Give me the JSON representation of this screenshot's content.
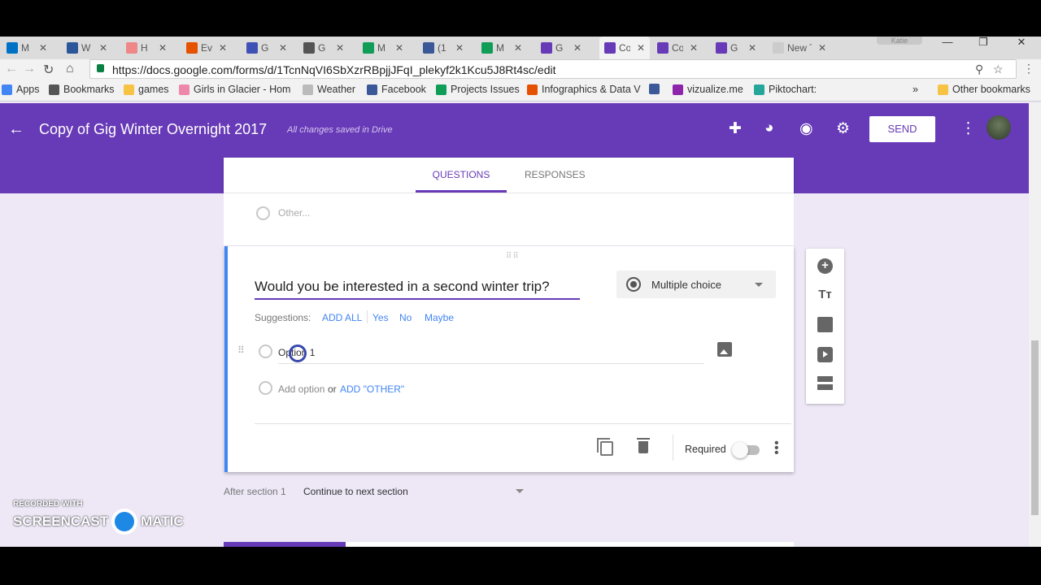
{
  "browser": {
    "tabs": [
      {
        "label": "M",
        "color": "#0072c6"
      },
      {
        "label": "W",
        "color": "#2b579a"
      },
      {
        "label": "H",
        "color": "#e88"
      },
      {
        "label": "Ev",
        "color": "#e65100"
      },
      {
        "label": "G",
        "color": "#3f51b5"
      },
      {
        "label": "G",
        "color": "#555"
      },
      {
        "label": "M",
        "color": "#0f9d58"
      },
      {
        "label": "(1",
        "color": "#3b5998"
      },
      {
        "label": "M",
        "color": "#0f9d58"
      },
      {
        "label": "G",
        "color": "#673ab7"
      },
      {
        "label": "Co",
        "color": "#673ab7",
        "active": true
      },
      {
        "label": "Co",
        "color": "#673ab7"
      },
      {
        "label": "G",
        "color": "#673ab7"
      },
      {
        "label": "New T",
        "color": "#ccc"
      }
    ],
    "profile": "Katie",
    "url": "https://docs.google.com/forms/d/1TcnNqVI6SbXzrRBpjjJFqI_plekyf2k1Kcu5J8Rt4sc/edit",
    "bookmarks": [
      {
        "label": "Apps",
        "color": "#4285f4"
      },
      {
        "label": "Bookmarks",
        "color": "#555"
      },
      {
        "label": "games",
        "color": "#f6c344"
      },
      {
        "label": "Girls in Glacier - Hom",
        "color": "#e8a"
      },
      {
        "label": "Weather",
        "color": "#bbb"
      },
      {
        "label": "Facebook",
        "color": "#3b5998"
      },
      {
        "label": "Projects Issues",
        "color": "#0f9d58"
      },
      {
        "label": "Infographics & Data V",
        "color": "#e65100"
      },
      {
        "label": "",
        "color": "#3b5998"
      },
      {
        "label": "vizualize.me",
        "color": "#8e24aa"
      },
      {
        "label": "Piktochart:",
        "color": "#26a69a"
      }
    ],
    "other_bookmarks": "Other bookmarks",
    "overflow": "»"
  },
  "form": {
    "title": "Copy of Gig Winter Overnight 2017",
    "saved_status": "All changes saved in Drive",
    "send_label": "SEND",
    "tabs": {
      "questions": "QUESTIONS",
      "responses": "RESPONSES"
    },
    "prev_other": "Other...",
    "question": {
      "title": "Would you be interested in a second winter trip?",
      "type": "Multiple choice",
      "suggestions_label": "Suggestions:",
      "suggestions": [
        "ADD ALL",
        "Yes",
        "No",
        "Maybe"
      ],
      "option1": "Option 1",
      "add_option": "Add option",
      "or": "or",
      "add_other": "ADD \"OTHER\"",
      "required_label": "Required"
    },
    "after_section": "After section 1",
    "continue_label": "Continue to next section"
  },
  "watermark": {
    "top": "RECORDED WITH",
    "left": "SCREENCAST",
    "right": "MATIC"
  },
  "colors": {
    "brand": "#673ab7",
    "accent_blue": "#4285f4",
    "background": "#ede7f6"
  }
}
